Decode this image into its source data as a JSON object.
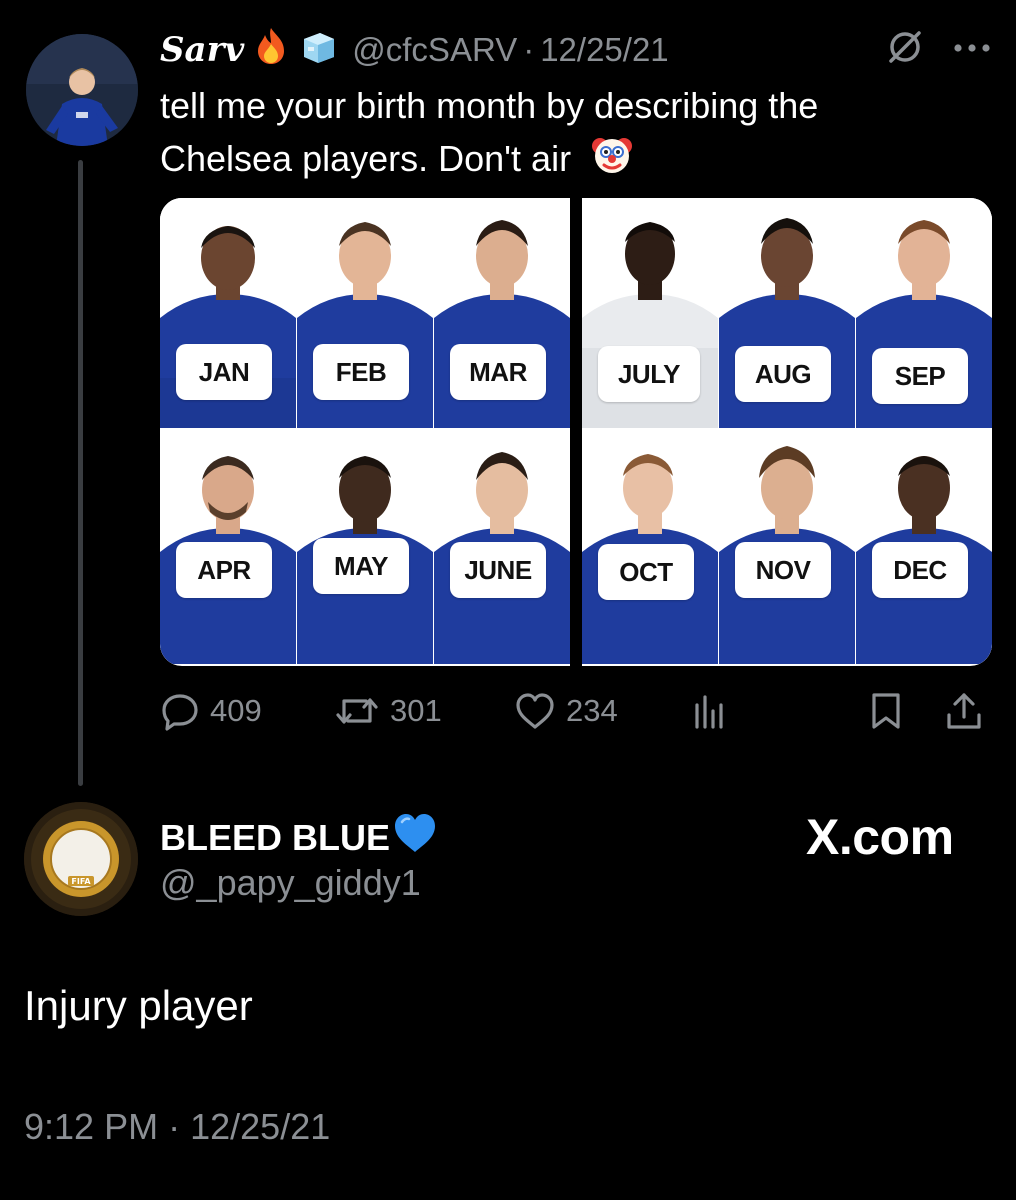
{
  "original_tweet": {
    "display_name": "Sarv",
    "name_emojis": [
      "fire-emoji",
      "ice-cube-emoji"
    ],
    "handle": "@cfcSARV",
    "separator": "·",
    "date": "12/25/21",
    "text_lines": [
      "tell me your birth month by describing the",
      "Chelsea players. Don't air"
    ],
    "text_emoji": "clown-face-emoji",
    "media": {
      "left_panel_months": [
        "JAN",
        "FEB",
        "MAR",
        "APR",
        "MAY",
        "JUNE"
      ],
      "right_panel_months": [
        "JULY",
        "AUG",
        "SEP",
        "OCT",
        "NOV",
        "DEC"
      ]
    },
    "stats": {
      "replies": "409",
      "reposts": "301",
      "likes": "234"
    },
    "icons": [
      "grok-icon",
      "more-icon",
      "reply-icon",
      "repost-icon",
      "like-icon",
      "views-icon",
      "bookmark-icon",
      "share-icon"
    ]
  },
  "reply_tweet": {
    "display_name": "BLEED BLUE",
    "name_emoji": "blue-heart-emoji",
    "handle": "@_papy_giddy1",
    "watermark": "X.com",
    "text": "Injury player",
    "time": "9:12 PM",
    "separator": "·",
    "date": "12/25/21"
  },
  "colors": {
    "background": "#000000",
    "primary_text": "#e7e9ea",
    "secondary_text": "#8b8f94",
    "thread_line": "#3a3d41",
    "kit_blue": "#1f3c9e"
  }
}
